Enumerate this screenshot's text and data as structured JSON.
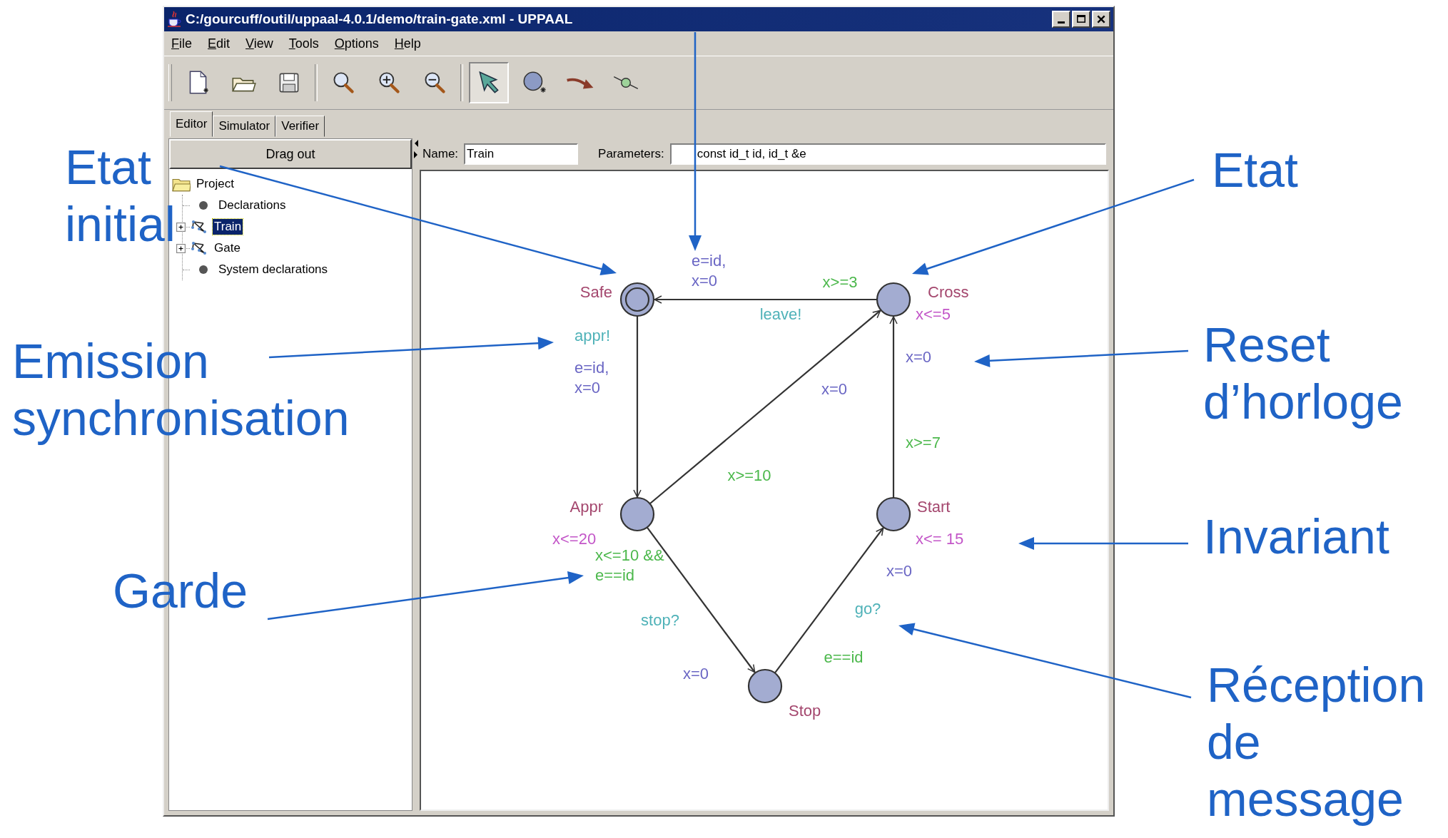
{
  "window": {
    "title": "C:/gourcuff/outil/uppaal-4.0.1/demo/train-gate.xml - UPPAAL"
  },
  "menu": [
    "File",
    "Edit",
    "View",
    "Tools",
    "Options",
    "Help"
  ],
  "toolbar": [
    {
      "kind": "new",
      "selected": false
    },
    {
      "kind": "open",
      "selected": false
    },
    {
      "kind": "save",
      "selected": false
    },
    {
      "kind": "zoom",
      "selected": false
    },
    {
      "kind": "zoom-in",
      "selected": false
    },
    {
      "kind": "zoom-out",
      "selected": false
    },
    {
      "kind": "select",
      "selected": true
    },
    {
      "kind": "location",
      "selected": false
    },
    {
      "kind": "edge",
      "selected": false
    },
    {
      "kind": "nail",
      "selected": false
    }
  ],
  "tabs": [
    {
      "label": "Editor",
      "selected": true
    },
    {
      "label": "Simulator",
      "selected": false
    },
    {
      "label": "Verifier",
      "selected": false
    }
  ],
  "drag_button": "Drag out",
  "tree": [
    {
      "label": "Project",
      "kind": "folder",
      "selected": false,
      "children": [
        {
          "label": "Declarations",
          "kind": "declarations",
          "selected": false
        },
        {
          "label": "Train",
          "kind": "template",
          "selected": true,
          "expanded": false
        },
        {
          "label": "Gate",
          "kind": "template",
          "selected": false,
          "expanded": false
        },
        {
          "label": "System declarations",
          "kind": "declarations",
          "selected": false
        }
      ]
    }
  ],
  "name_field": {
    "label": "Name:",
    "value": "Train"
  },
  "parameters_field": {
    "label": "Parameters:",
    "value": "const id_t id, id_t &e"
  },
  "locations": [
    {
      "name": "Safe",
      "initial": true
    },
    {
      "name": "Cross",
      "invariant": "x<=5",
      "initial": false
    },
    {
      "name": "Appr",
      "invariant": "x<=20",
      "initial": false
    },
    {
      "name": "Start",
      "invariant": "x<= 15",
      "initial": false
    },
    {
      "name": "Stop",
      "initial": false
    }
  ],
  "edges": [
    {
      "labels": [
        {
          "kind": "guard",
          "lines": [
            "x>=3"
          ]
        },
        {
          "kind": "sync",
          "lines": [
            "leave!"
          ]
        },
        {
          "kind": "update",
          "lines": [
            "e=id,",
            "x=0"
          ]
        }
      ]
    },
    {
      "labels": [
        {
          "kind": "sync",
          "lines": [
            "appr!"
          ]
        },
        {
          "kind": "update",
          "lines": [
            "e=id,",
            "x=0"
          ]
        }
      ]
    },
    {
      "labels": [
        {
          "kind": "guard",
          "lines": [
            "x>=10"
          ]
        },
        {
          "kind": "update",
          "lines": [
            "x=0"
          ]
        }
      ]
    },
    {
      "labels": [
        {
          "kind": "update",
          "lines": [
            "x=0"
          ]
        },
        {
          "kind": "guard",
          "lines": [
            "x>=7"
          ]
        }
      ]
    },
    {
      "labels": [
        {
          "kind": "guard",
          "lines": [
            "x<=10 &&",
            "e==id"
          ]
        },
        {
          "kind": "sync",
          "lines": [
            "stop?"
          ]
        },
        {
          "kind": "update",
          "lines": [
            "x=0"
          ]
        }
      ]
    },
    {
      "labels": [
        {
          "kind": "guard",
          "lines": [
            "e==id"
          ]
        },
        {
          "kind": "sync",
          "lines": [
            "go?"
          ]
        },
        {
          "kind": "update",
          "lines": [
            "x=0"
          ]
        }
      ]
    }
  ],
  "annotations": [
    {
      "lines": [
        "Etat",
        "initial"
      ]
    },
    {
      "lines": [
        "Etat"
      ]
    },
    {
      "lines": [
        "Emission",
        "synchronisation"
      ]
    },
    {
      "lines": [
        "Reset",
        "d’horloge"
      ]
    },
    {
      "lines": [
        "Invariant"
      ]
    },
    {
      "lines": [
        "Garde"
      ]
    },
    {
      "lines": [
        "Réception",
        "de",
        "message"
      ]
    }
  ]
}
